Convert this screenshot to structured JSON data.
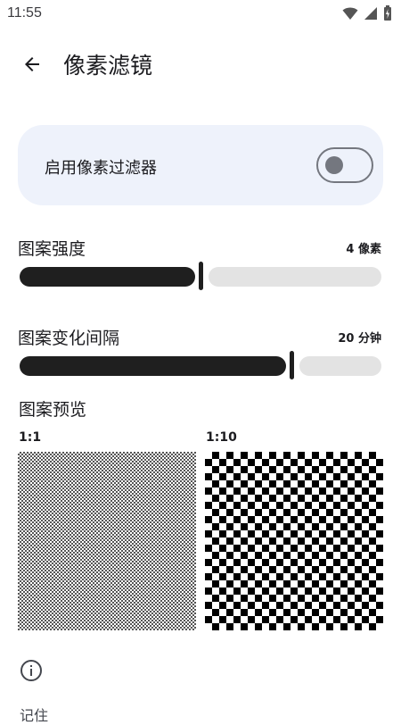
{
  "status_bar": {
    "time": "11:55"
  },
  "app_bar": {
    "title": "像素滤镜",
    "back_icon": "arrow-back-icon"
  },
  "toggle": {
    "label": "启用像素过滤器",
    "enabled": false
  },
  "pattern_strength": {
    "title": "图案强度",
    "value_text": "4 像素",
    "fraction": 0.5
  },
  "pattern_interval": {
    "title": "图案变化间隔",
    "value_text": "20 分钟",
    "fraction": 0.75
  },
  "preview": {
    "title": "图案预览",
    "left_label": "1:1",
    "right_label": "1:10"
  },
  "footer": {
    "info_icon": "info-icon",
    "text": "记住"
  },
  "colors": {
    "card_bg": "#eef2fb",
    "track_active": "#1f1f1f",
    "track_inactive": "#e3e3e3",
    "switch_outline": "#74777f"
  }
}
